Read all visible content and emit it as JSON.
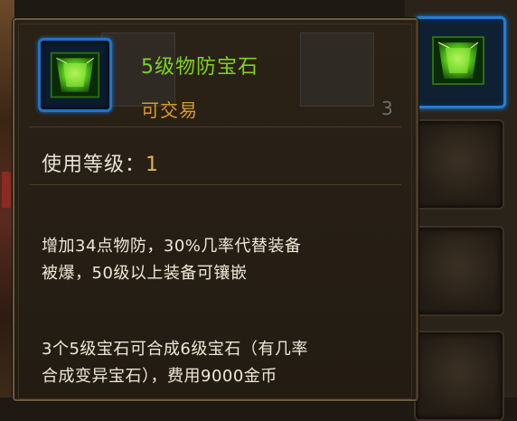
{
  "item": {
    "name": "5级物防宝石",
    "tradable": "可交易",
    "level_label": "使用等级：",
    "level_value": "1",
    "description_1_line1": "增加34点物防，30%几率代替装备",
    "description_1_line2": "被爆，50级以上装备可镶嵌",
    "description_2_line1": "3个5级宝石可合成6级宝石（有几率",
    "description_2_line2": "合成变异宝石），费用9000金币",
    "icon": "green-gem-icon"
  },
  "background": {
    "slot_count_number": "3"
  },
  "colors": {
    "name": "#7ed321",
    "tradable": "#d99a2b",
    "level_value": "#e0b64a",
    "text": "#efe8d6",
    "icon_border": "#1f73c8"
  }
}
